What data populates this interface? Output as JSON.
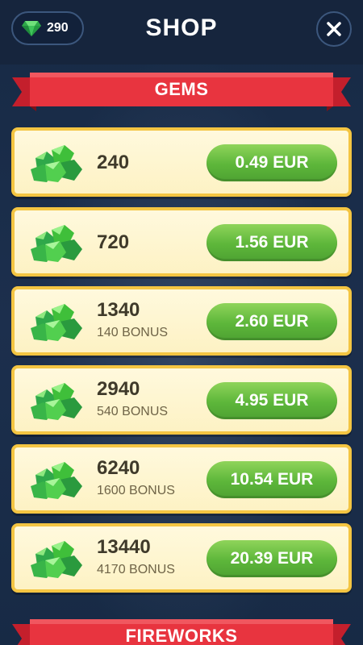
{
  "header": {
    "title": "SHOP",
    "gem_balance": "290",
    "gem_icon": "gem-icon",
    "close_icon": "close-icon"
  },
  "sections": {
    "gems": {
      "title": "GEMS"
    },
    "fireworks": {
      "title": "FIREWORKS"
    }
  },
  "offers": [
    {
      "amount": "240",
      "bonus": "",
      "price": "0.49 EUR"
    },
    {
      "amount": "720",
      "bonus": "",
      "price": "1.56 EUR"
    },
    {
      "amount": "1340",
      "bonus": "140 BONUS",
      "price": "2.60 EUR"
    },
    {
      "amount": "2940",
      "bonus": "540 BONUS",
      "price": "4.95 EUR"
    },
    {
      "amount": "6240",
      "bonus": "1600 BONUS",
      "price": "10.54 EUR"
    },
    {
      "amount": "13440",
      "bonus": "4170 BONUS",
      "price": "20.39 EUR"
    }
  ],
  "colors": {
    "background": "#1a2b47",
    "ribbon": "#e8343f",
    "card": "#fdf2c4",
    "card_border": "#f4c542",
    "price_button": "#5db63a",
    "gem": "#3fbf3a"
  }
}
